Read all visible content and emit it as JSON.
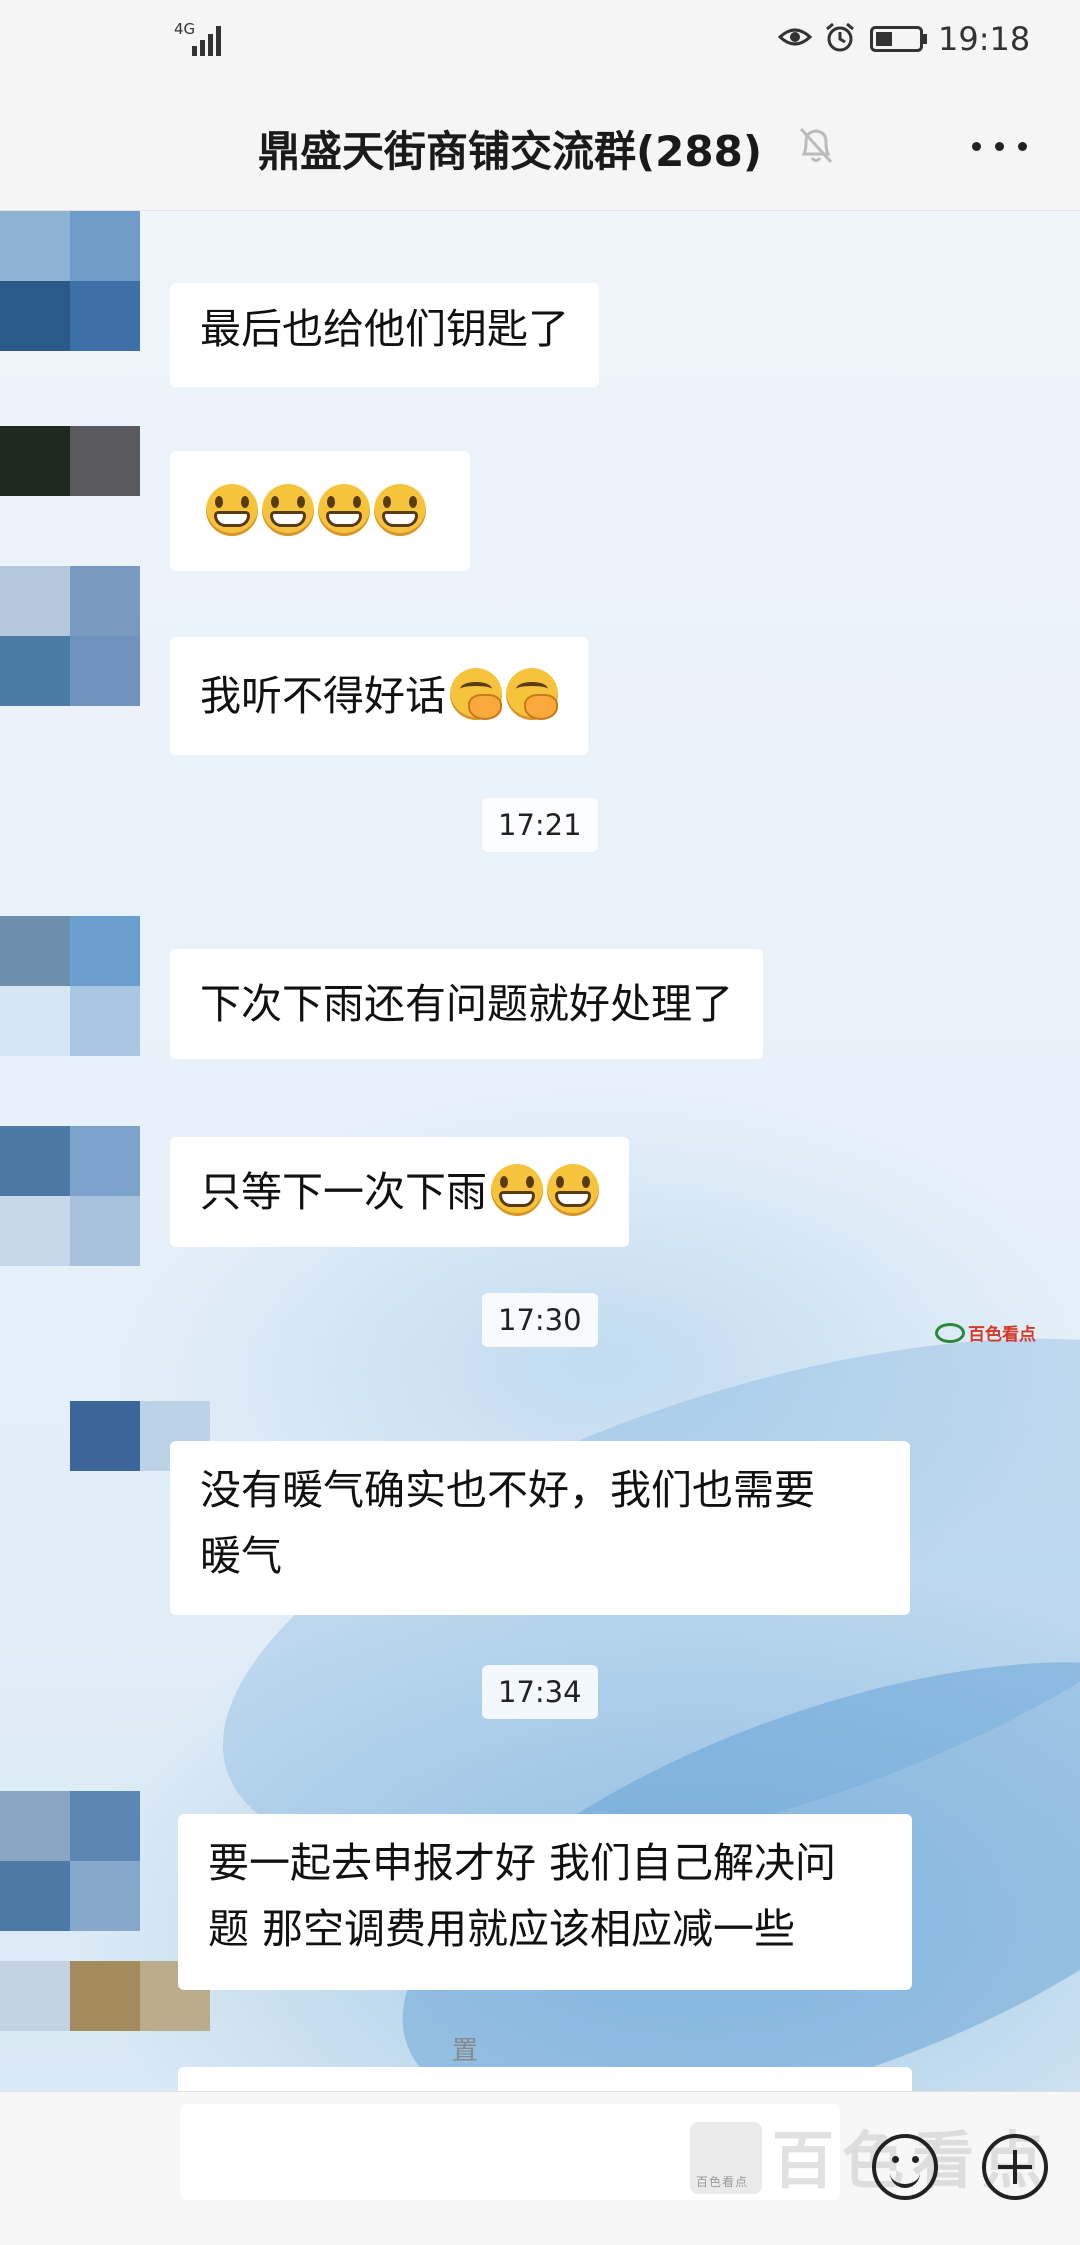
{
  "status_bar": {
    "network_label": "4G",
    "time": "19:18",
    "icons": [
      "signal-icon",
      "eye-icon",
      "alarm-icon",
      "battery-icon"
    ]
  },
  "header": {
    "title": "鼎盛天街商铺交流群(288)",
    "icons": [
      "mute-icon",
      "more-icon"
    ]
  },
  "messages": [
    {
      "type": "text",
      "text": "最后也给他们钥匙了"
    },
    {
      "type": "emoji",
      "emojis": [
        "grin",
        "grin",
        "grin",
        "grin"
      ]
    },
    {
      "type": "text",
      "text": "我听不得好话",
      "emojis": [
        "facepalm",
        "facepalm"
      ]
    },
    {
      "type": "time",
      "text": "17:21"
    },
    {
      "type": "text",
      "text": "下次下雨还有问题就好处理了"
    },
    {
      "type": "text",
      "text": "只等下一次下雨",
      "emojis": [
        "grin",
        "grin"
      ]
    },
    {
      "type": "time",
      "text": "17:30"
    },
    {
      "type": "text",
      "lines": [
        "没有暖气确实也不好，我们也需要",
        "暖气"
      ]
    },
    {
      "type": "time",
      "text": "17:34"
    },
    {
      "type": "text",
      "lines": [
        "要一起去申报才好 我们自己解决问",
        "题 那空调费用就应该相应减一些"
      ]
    }
  ],
  "system_note_fragment": "置",
  "watermarks": {
    "middle": "百色看点",
    "bottom": "百色看点",
    "bottom_sub": "百色看点"
  },
  "input_bar": {
    "icons": [
      "emoji-icon",
      "plus-icon"
    ]
  },
  "colors": {
    "bubble": "#ffffff",
    "chat_background": "#e8f1f9",
    "watermark_red": "#d43a2a"
  }
}
